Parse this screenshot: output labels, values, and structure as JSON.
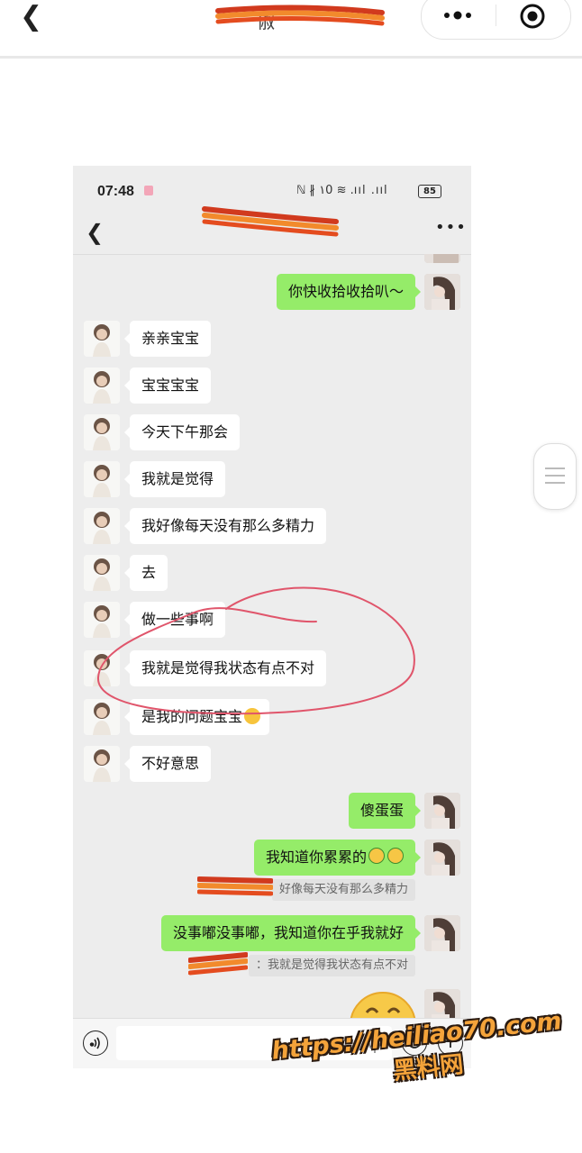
{
  "browser": {
    "title_fragment": "俶"
  },
  "status_bar": {
    "time": "07:48",
    "signal_icons": "ℕ ∦ ١0 ≋ .ııl .ııl",
    "battery": "85"
  },
  "chat": {
    "messages": [
      {
        "side": "right",
        "text": "你快收拾收拾叭～"
      },
      {
        "side": "left",
        "text": "亲亲宝宝"
      },
      {
        "side": "left",
        "text": "宝宝宝宝"
      },
      {
        "side": "left",
        "text": "今天下午那会"
      },
      {
        "side": "left",
        "text": "我就是觉得"
      },
      {
        "side": "left",
        "text": "我好像每天没有那么多精力"
      },
      {
        "side": "left",
        "text": "去"
      },
      {
        "side": "left",
        "text": "做一些事啊"
      },
      {
        "side": "left",
        "text": "我就是觉得我状态有点不对"
      },
      {
        "side": "left",
        "text": "是我的问题宝宝"
      },
      {
        "side": "left",
        "text": "不好意思"
      },
      {
        "side": "right",
        "text": "傻蛋蛋"
      },
      {
        "side": "right",
        "text": "我知道你累累的"
      },
      {
        "side": "right",
        "text": "没事嘟没事嘟，我知道你在乎我就好"
      }
    ],
    "quotes": [
      {
        "text": "好像每天没有那么多精力"
      },
      {
        "text": "：我就是觉得我状态有点不对"
      }
    ]
  },
  "watermark": {
    "url": "https://heiliao70.com",
    "name": "黑料网"
  },
  "colors": {
    "sent_bubble": "#95ec69",
    "received_bubble": "#ffffff",
    "chat_bg": "#ededed",
    "annotation_circle": "#e0556b",
    "watermark": "#f4a33a"
  }
}
